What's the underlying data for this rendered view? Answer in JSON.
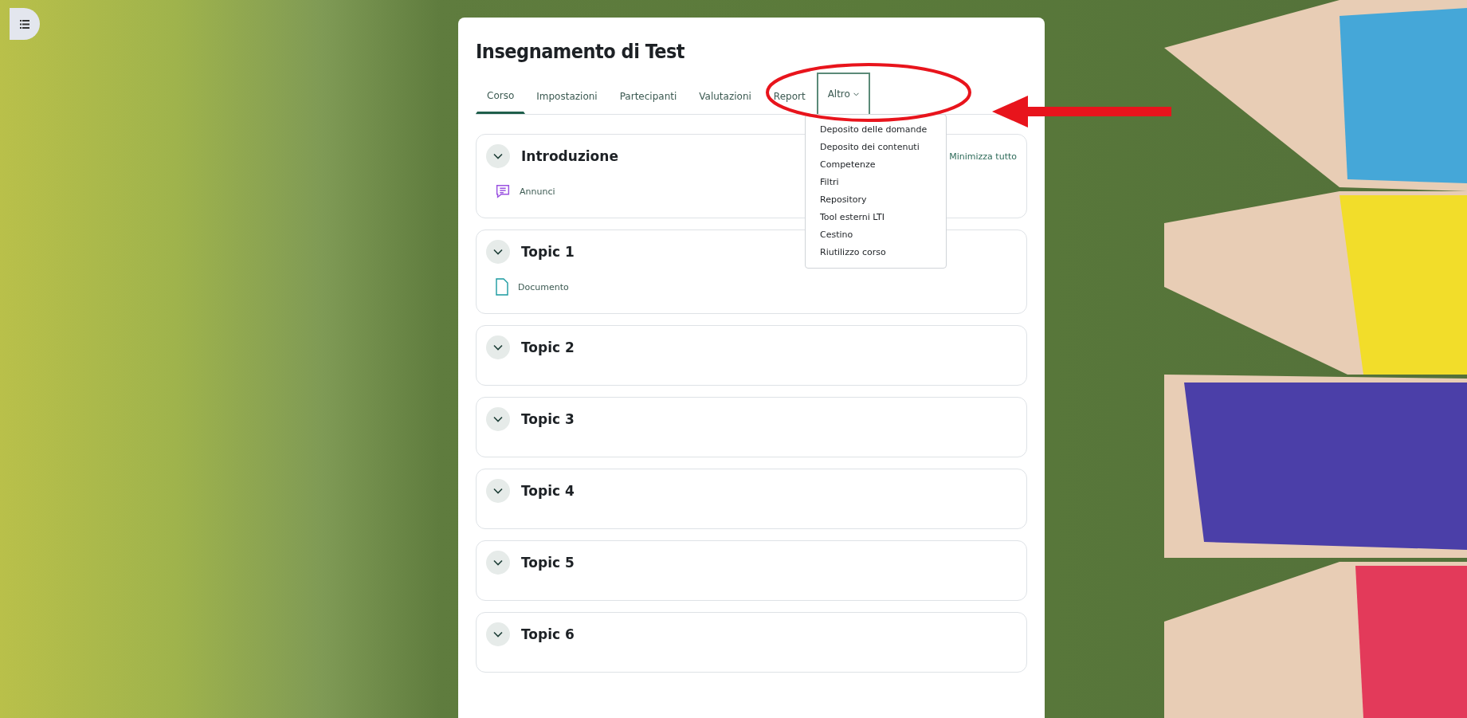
{
  "course": {
    "title": "Insegnamento di Test"
  },
  "tabs": [
    {
      "label": "Corso",
      "selected": true,
      "kind": "link"
    },
    {
      "label": "Impostazioni",
      "selected": false,
      "kind": "link"
    },
    {
      "label": "Partecipanti",
      "selected": false,
      "kind": "link"
    },
    {
      "label": "Valutazioni",
      "selected": false,
      "kind": "link"
    },
    {
      "label": "Report",
      "selected": false,
      "kind": "link"
    },
    {
      "label": "Altro",
      "selected": false,
      "kind": "menu",
      "expanded": true
    }
  ],
  "more_menu": [
    "Deposito delle domande",
    "Deposito dei contenuti",
    "Competenze",
    "Filtri",
    "Repository",
    "Tool esterni LTI",
    "Cestino",
    "Riutilizzo corso"
  ],
  "collapse_all": "Minimizza tutto",
  "sections": [
    {
      "title": "Introduzione",
      "expanded": true,
      "activities": [
        {
          "kind": "forum",
          "name": "Annunci"
        }
      ]
    },
    {
      "title": "Topic 1",
      "expanded": true,
      "activities": [
        {
          "kind": "pdf",
          "name": "Documento"
        }
      ]
    },
    {
      "title": "Topic 2",
      "expanded": true
    },
    {
      "title": "Topic 3",
      "expanded": true
    },
    {
      "title": "Topic 4",
      "expanded": true
    },
    {
      "title": "Topic 5",
      "expanded": true
    },
    {
      "title": "Topic 6",
      "expanded": true
    }
  ]
}
